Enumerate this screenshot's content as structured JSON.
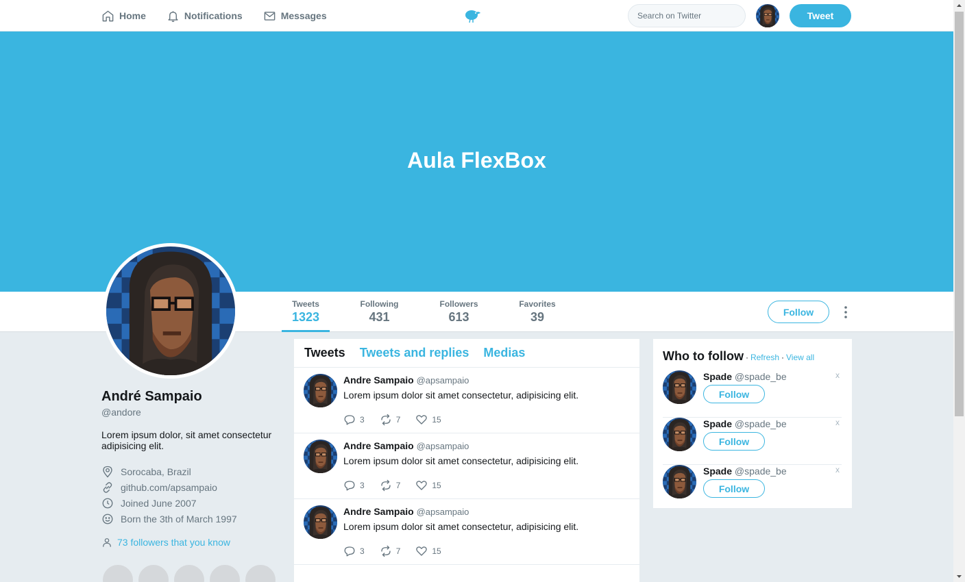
{
  "nav": {
    "home": "Home",
    "notifications": "Notifications",
    "messages": "Messages",
    "search_placeholder": "Search on Twitter",
    "tweet_button": "Tweet"
  },
  "cover": {
    "title": "Aula FlexBox",
    "color": "#3ab5e0"
  },
  "stats": [
    {
      "label": "Tweets",
      "value": "1323"
    },
    {
      "label": "Following",
      "value": "431"
    },
    {
      "label": "Followers",
      "value": "613"
    },
    {
      "label": "Favorites",
      "value": "39"
    }
  ],
  "follow_button": "Follow",
  "profile": {
    "name": "André Sampaio",
    "handle": "@andore",
    "bio": "Lorem ipsum dolor, sit amet consectetur adipisicing elit.",
    "location": "Sorocaba, Brazil",
    "website": "github.com/apsampaio",
    "joined": "Joined June 2007",
    "born": "Born the 3th of March 1997",
    "followers_you_know": "73 followers that you know"
  },
  "tabs": [
    "Tweets",
    "Tweets and replies",
    "Medias"
  ],
  "tweets": [
    {
      "name": "Andre Sampaio",
      "handle": "@apsampaio",
      "text": "Lorem ipsum dolor sit amet consectetur, adipisicing elit.",
      "replies": "3",
      "retweets": "7",
      "likes": "15"
    },
    {
      "name": "Andre Sampaio",
      "handle": "@apsampaio",
      "text": "Lorem ipsum dolor sit amet consectetur, adipisicing elit.",
      "replies": "3",
      "retweets": "7",
      "likes": "15"
    },
    {
      "name": "Andre Sampaio",
      "handle": "@apsampaio",
      "text": "Lorem ipsum dolor sit amet consectetur, adipisicing elit.",
      "replies": "3",
      "retweets": "7",
      "likes": "15"
    }
  ],
  "who_to_follow": {
    "title": "Who to follow",
    "separator": "·",
    "refresh": "Refresh",
    "view_all": "View all",
    "suggestions": [
      {
        "name": "Spade",
        "handle": "@spade_be",
        "button": "Follow",
        "dismiss": "x"
      },
      {
        "name": "Spade",
        "handle": "@spade_be",
        "button": "Follow",
        "dismiss": "x"
      },
      {
        "name": "Spade",
        "handle": "@spade_be",
        "button": "Follow",
        "dismiss": "x"
      }
    ]
  },
  "icons": [
    "home-icon",
    "bell-icon",
    "mail-icon",
    "bird-logo-icon",
    "more-vertical-icon",
    "location-pin-icon",
    "link-icon",
    "clock-icon",
    "smile-icon",
    "user-icon",
    "reply-icon",
    "retweet-icon",
    "heart-icon"
  ]
}
